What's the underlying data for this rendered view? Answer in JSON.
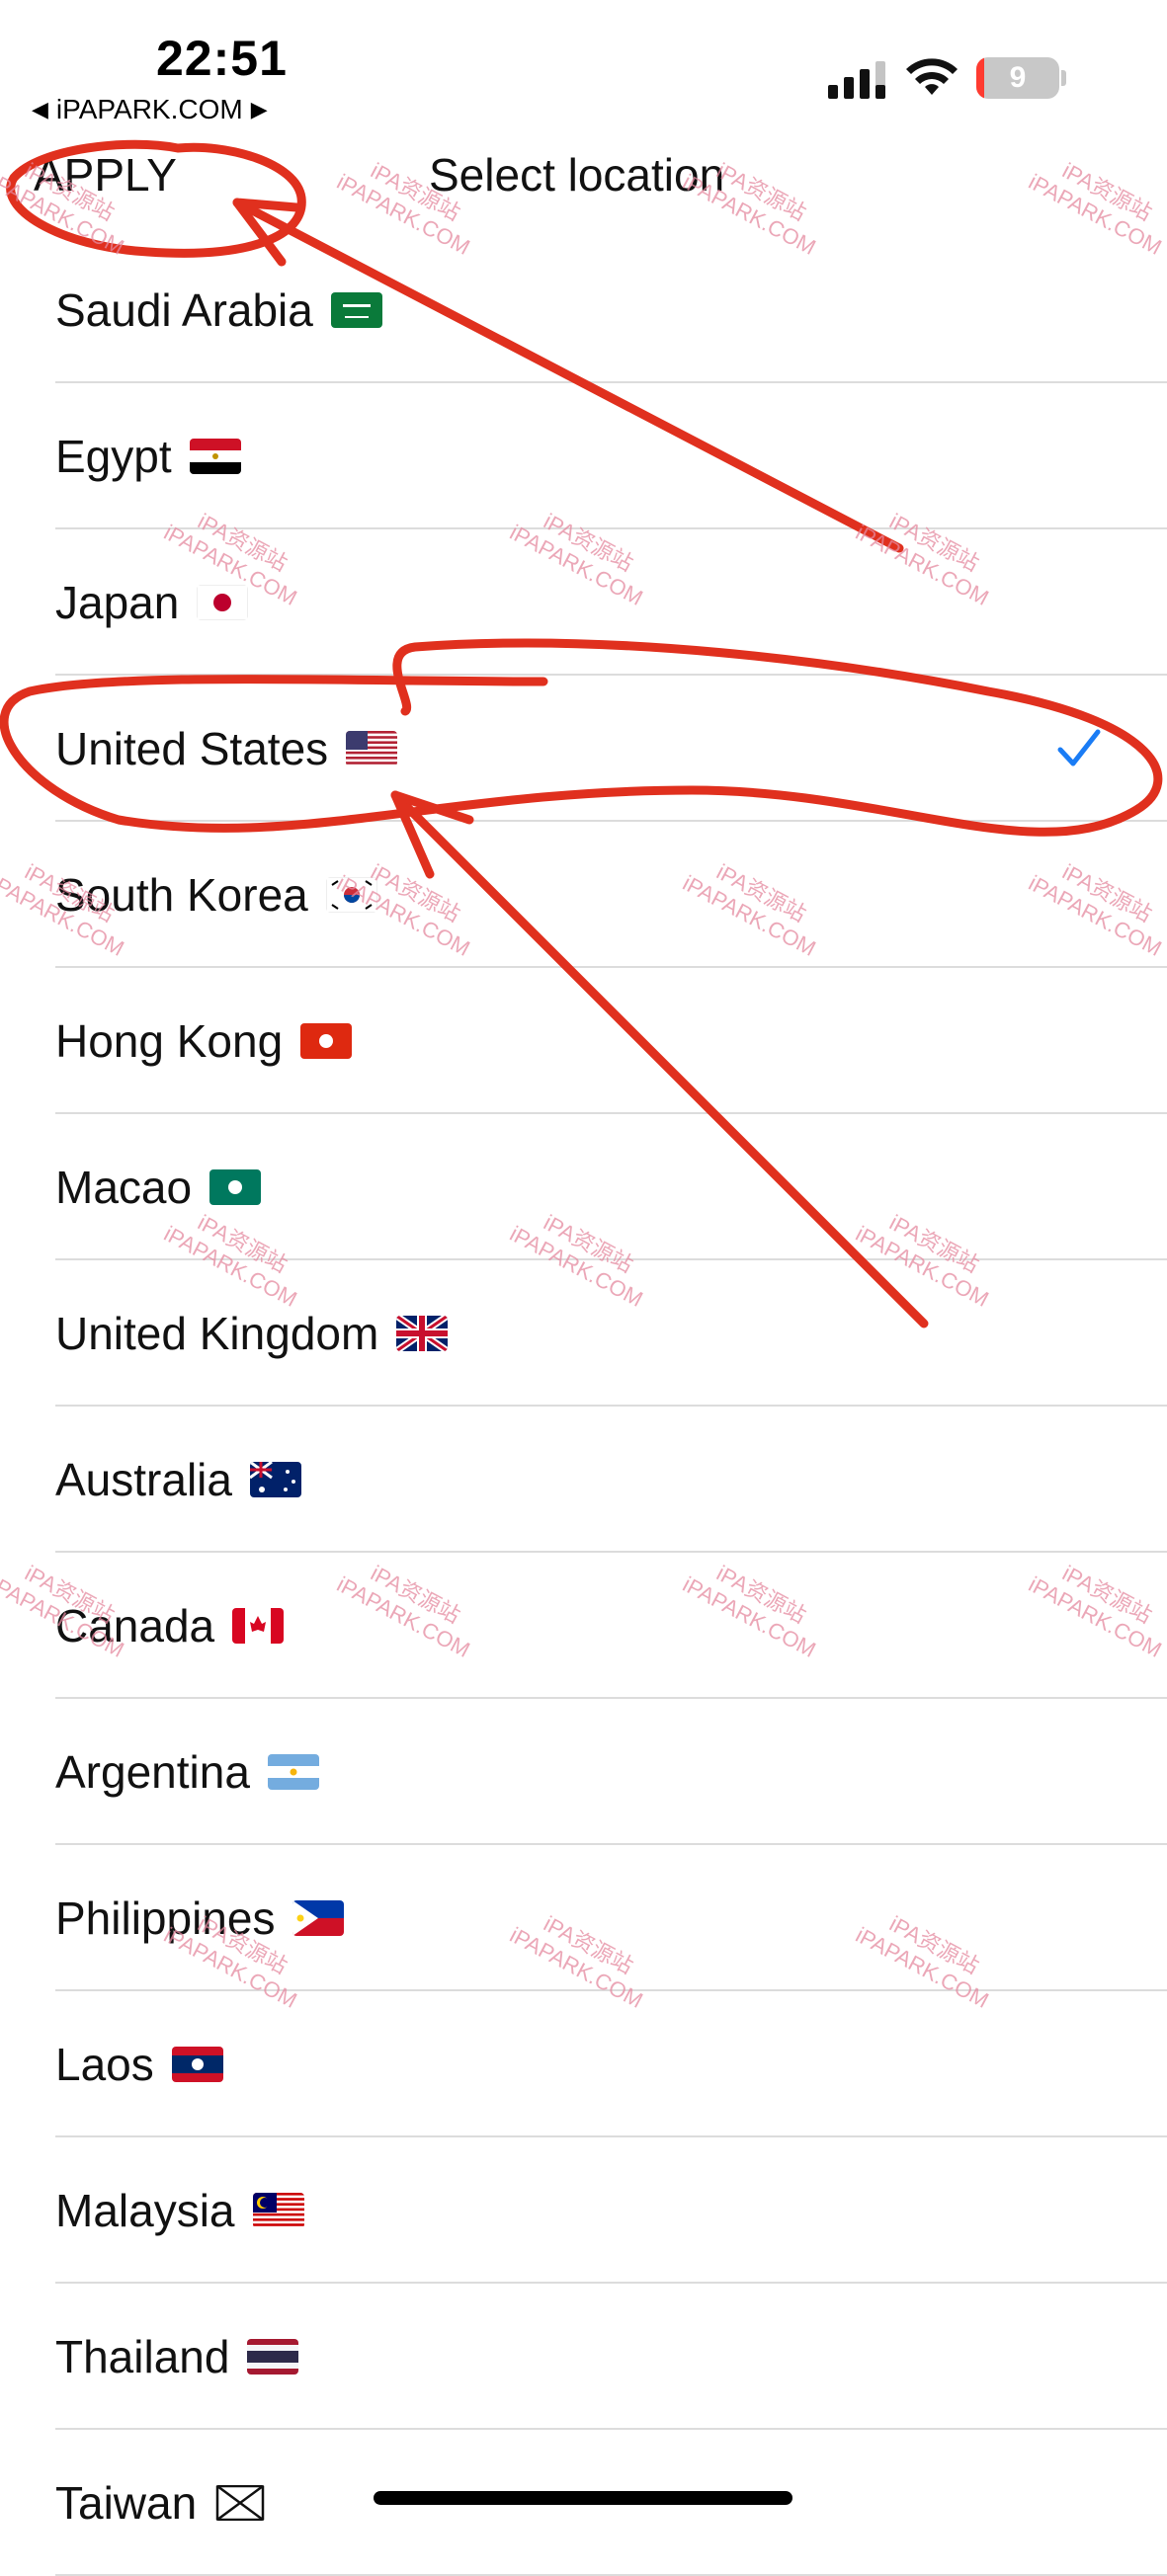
{
  "status_bar": {
    "time": "22:51",
    "back_label": "iPAPARK.COM",
    "battery": "9",
    "icons": [
      "signal-icon",
      "wifi-icon",
      "battery-icon"
    ]
  },
  "nav": {
    "apply_label": "APPLY",
    "title": "Select location"
  },
  "locations": [
    {
      "name": "Saudi Arabia",
      "flag": "sa"
    },
    {
      "name": "Egypt",
      "flag": "eg"
    },
    {
      "name": "Japan",
      "flag": "jp"
    },
    {
      "name": "United States",
      "flag": "us",
      "selected": true
    },
    {
      "name": "South Korea",
      "flag": "kr"
    },
    {
      "name": "Hong Kong",
      "flag": "hk"
    },
    {
      "name": "Macao",
      "flag": "mo"
    },
    {
      "name": "United Kingdom",
      "flag": "gb"
    },
    {
      "name": "Australia",
      "flag": "au"
    },
    {
      "name": "Canada",
      "flag": "ca"
    },
    {
      "name": "Argentina",
      "flag": "ar"
    },
    {
      "name": "Philippines",
      "flag": "ph"
    },
    {
      "name": "Laos",
      "flag": "la"
    },
    {
      "name": "Malaysia",
      "flag": "my"
    },
    {
      "name": "Thailand",
      "flag": "th"
    },
    {
      "name": "Taiwan",
      "flag": "tw"
    }
  ],
  "watermark": {
    "line1": "iPA资源站",
    "line2": "iPAPARK.COM"
  },
  "colors": {
    "accent": "#1a7cf5",
    "annotation": "#e0301e",
    "watermark": "#e58aa0"
  }
}
